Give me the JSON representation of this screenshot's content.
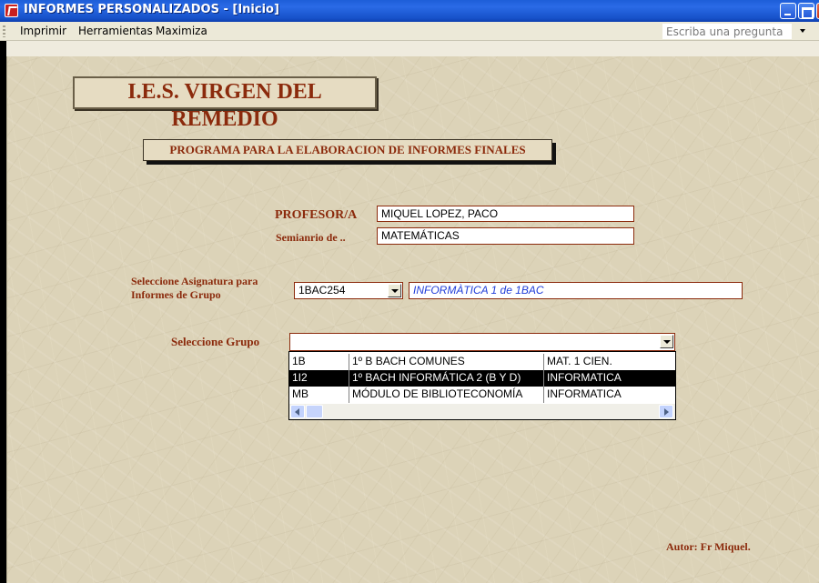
{
  "window": {
    "title": "INFORMES PERSONALIZADOS - [Inicio]"
  },
  "menubar": {
    "items": [
      "Imprimir",
      "Herramientas",
      "Maximiza"
    ],
    "help_placeholder": "Escriba una pregunta"
  },
  "form": {
    "school_title": "I.E.S. VIRGEN DEL REMEDIO",
    "program_title": "PROGRAMA PARA LA ELABORACION DE INFORMES FINALES",
    "profesor_label": "PROFESOR/A",
    "profesor_value": "MIQUEL LOPEZ, PACO",
    "seminario_label": "Semianrio de ..",
    "seminario_value": "MATEMÁTICAS",
    "asignatura_label": "Seleccione Asignatura para Informes de Grupo",
    "asignatura_code": "1BAC254",
    "asignatura_name": "INFORMÀTICA 1 de 1BAC",
    "grupo_label": "Seleccione  Grupo",
    "grupo_value": "",
    "grupo_options": [
      {
        "code": "1B",
        "name": "1º B BACH COMUNES",
        "dept": "MAT. 1 CIEN."
      },
      {
        "code": "1I2",
        "name": "1º BACH INFORMÁTICA 2 (B Y D)",
        "dept": "INFORMATICA"
      },
      {
        "code": "MB",
        "name": "MÓDULO DE BIBLIOTECONOMÍA",
        "dept": "INFORMATICA"
      }
    ],
    "grupo_selected_index": 1,
    "autor": "Autor: Fr Miquel."
  },
  "colors": {
    "label_text": "#8b2a0c",
    "asignatura_text": "#1f3cd8",
    "titlebar": "#1d5ed8"
  }
}
